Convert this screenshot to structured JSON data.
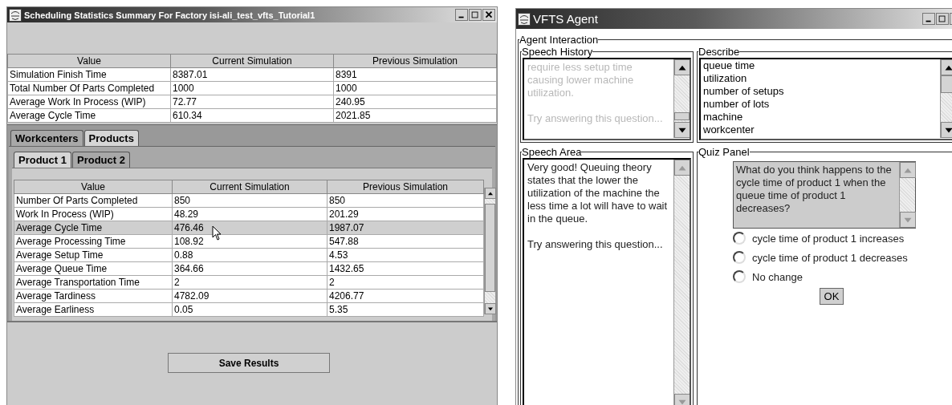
{
  "summary_window": {
    "title": "Scheduling Statistics Summary For Factory isi-ali_test_vfts_Tutorial1",
    "summary_table": {
      "columns": [
        "Value",
        "Current Simulation",
        "Previous Simulation"
      ],
      "rows": [
        [
          "Simulation Finish Time",
          "8387.01",
          "8391"
        ],
        [
          "Total Number Of Parts Completed",
          "1000",
          "1000"
        ],
        [
          "Average Work In Process (WIP)",
          "72.77",
          "240.95"
        ],
        [
          "Average Cycle Time",
          "610.34",
          "2021.85"
        ]
      ]
    },
    "category_tabs": [
      {
        "label": "Workcenters",
        "selected": false
      },
      {
        "label": "Products",
        "selected": true
      }
    ],
    "product_tabs": [
      {
        "label": "Product 1",
        "selected": true
      },
      {
        "label": "Product 2",
        "selected": false
      }
    ],
    "product_table": {
      "columns": [
        "Value",
        "Current Simulation",
        "Previous Simulation"
      ],
      "rows": [
        {
          "cells": [
            "Number Of Parts Completed",
            "850",
            "850"
          ],
          "selected": false
        },
        {
          "cells": [
            "Work In Process (WIP)",
            "48.29",
            "201.29"
          ],
          "selected": false
        },
        {
          "cells": [
            "Average Cycle Time",
            "476.46",
            "1987.07"
          ],
          "selected": true
        },
        {
          "cells": [
            "Average Processing Time",
            "108.92",
            "547.88"
          ],
          "selected": false
        },
        {
          "cells": [
            "Average Setup Time",
            "0.88",
            "4.53"
          ],
          "selected": false
        },
        {
          "cells": [
            "Average Queue Time",
            "364.66",
            "1432.65"
          ],
          "selected": false
        },
        {
          "cells": [
            "Average Transportation Time",
            "2",
            "2"
          ],
          "selected": false
        },
        {
          "cells": [
            "Average Tardiness",
            "4782.09",
            "4206.77"
          ],
          "selected": false
        },
        {
          "cells": [
            "Average Earliness",
            "0.05",
            "5.35"
          ],
          "selected": false
        }
      ]
    },
    "save_button": "Save Results"
  },
  "agent_window": {
    "title": "VFTS Agent",
    "group_title": "Agent Interaction",
    "speech_history": {
      "title": "Speech History",
      "disabled": true,
      "paragraphs": [
        "require less setup time causing lower machine utilization.",
        "Try answering this question..."
      ]
    },
    "describe": {
      "title": "Describe",
      "items": [
        "queue time",
        "utilization",
        "number of setups",
        "number of lots",
        "machine",
        "workcenter"
      ]
    },
    "speech_area": {
      "title": "Speech Area",
      "paragraphs": [
        "Very good! Queuing theory states that the lower the utilization of the machine the less time a lot will have to wait in the queue.",
        "Try answering this question..."
      ]
    },
    "quiz_panel": {
      "title": "Quiz Panel",
      "question": "What do you think happens to the cycle time of product 1 when the queue time of product 1 decreases?",
      "options": [
        {
          "label": "cycle time of product 1 increases",
          "selected": false
        },
        {
          "label": "cycle time of product 1 decreases",
          "selected": false
        },
        {
          "label": "No change",
          "selected": false
        }
      ],
      "ok_button": "OK"
    }
  }
}
